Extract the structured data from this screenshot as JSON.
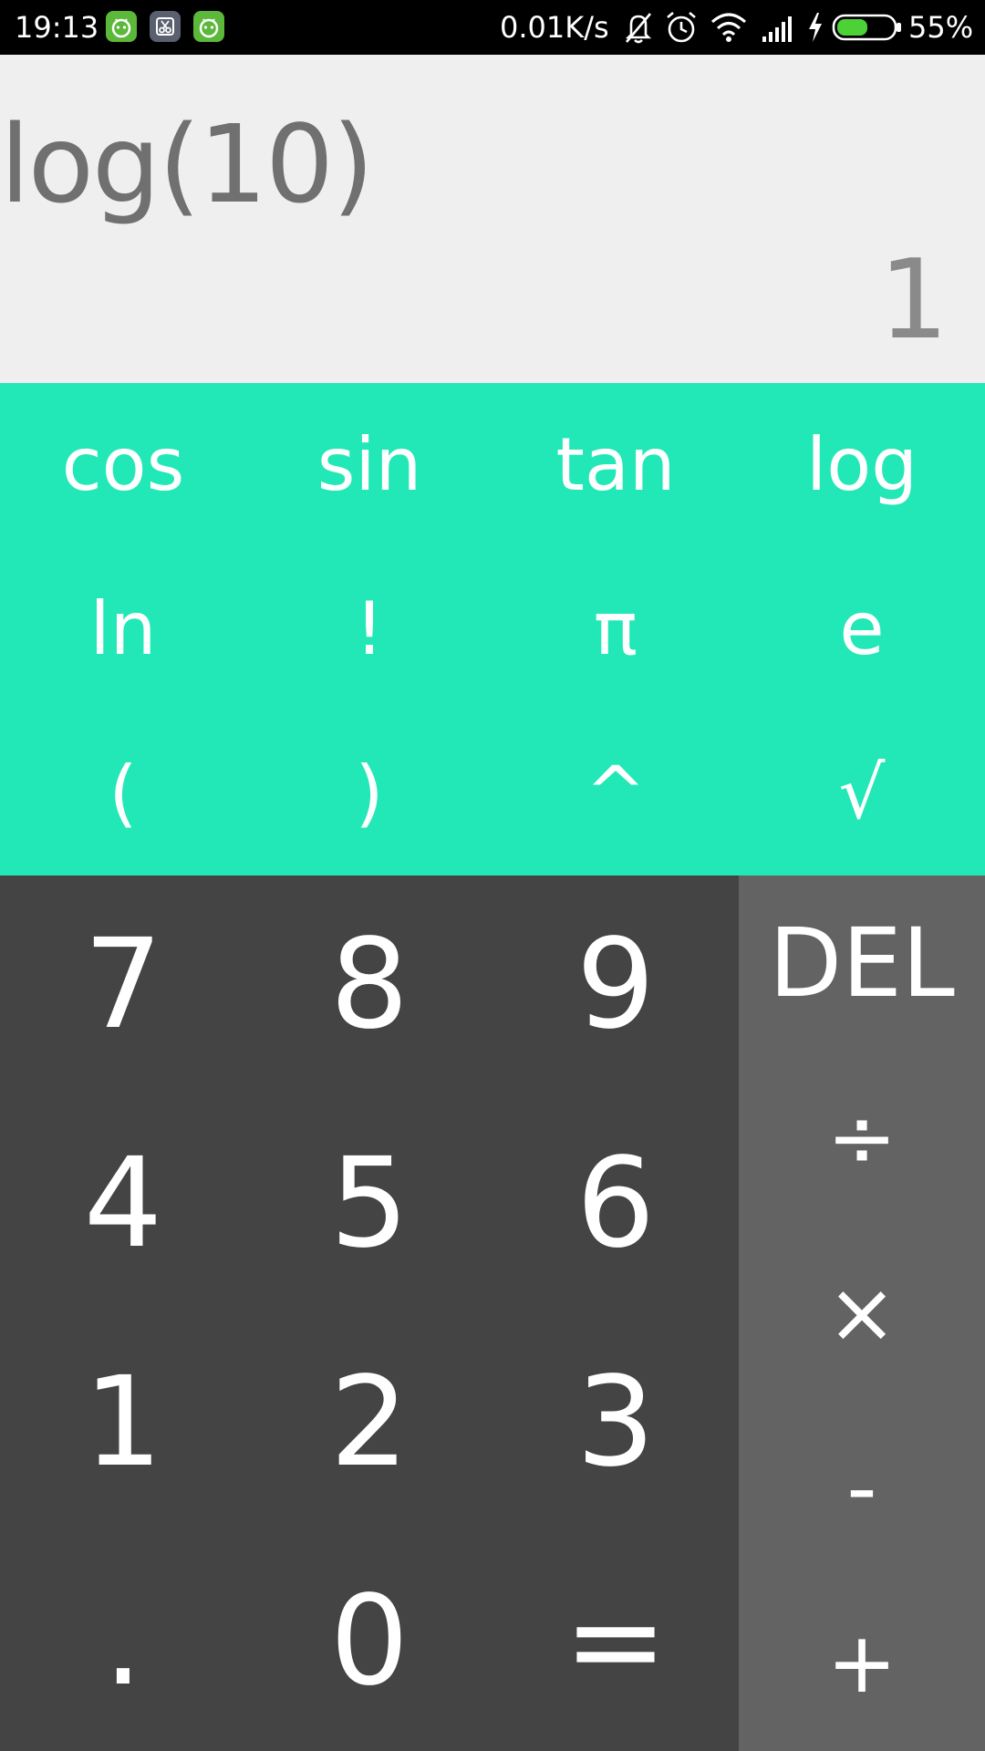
{
  "status_bar": {
    "time": "19:13",
    "apps": [
      "android-app-icon",
      "scissors-app-icon",
      "android-app-icon"
    ],
    "net_speed": "0.01K/s",
    "battery_percent": "55%",
    "battery_level": 55,
    "battery_color": "#4cd137"
  },
  "display": {
    "expression": "log(10)",
    "result": "1"
  },
  "advanced_keys": [
    [
      "cos",
      "sin",
      "tan",
      "log"
    ],
    [
      "ln",
      "!",
      "π",
      "e"
    ],
    [
      "(",
      ")",
      "^",
      "√"
    ]
  ],
  "number_keys": [
    [
      "7",
      "8",
      "9"
    ],
    [
      "4",
      "5",
      "6"
    ],
    [
      "1",
      "2",
      "3"
    ],
    [
      ".",
      "0",
      "="
    ]
  ],
  "operator_keys": [
    "DEL",
    "÷",
    "×",
    "-",
    "+"
  ],
  "colors": {
    "display_bg": "#efefef",
    "advanced_bg": "#21e8b6",
    "numpad_bg": "#444444",
    "ops_bg": "#636363"
  }
}
